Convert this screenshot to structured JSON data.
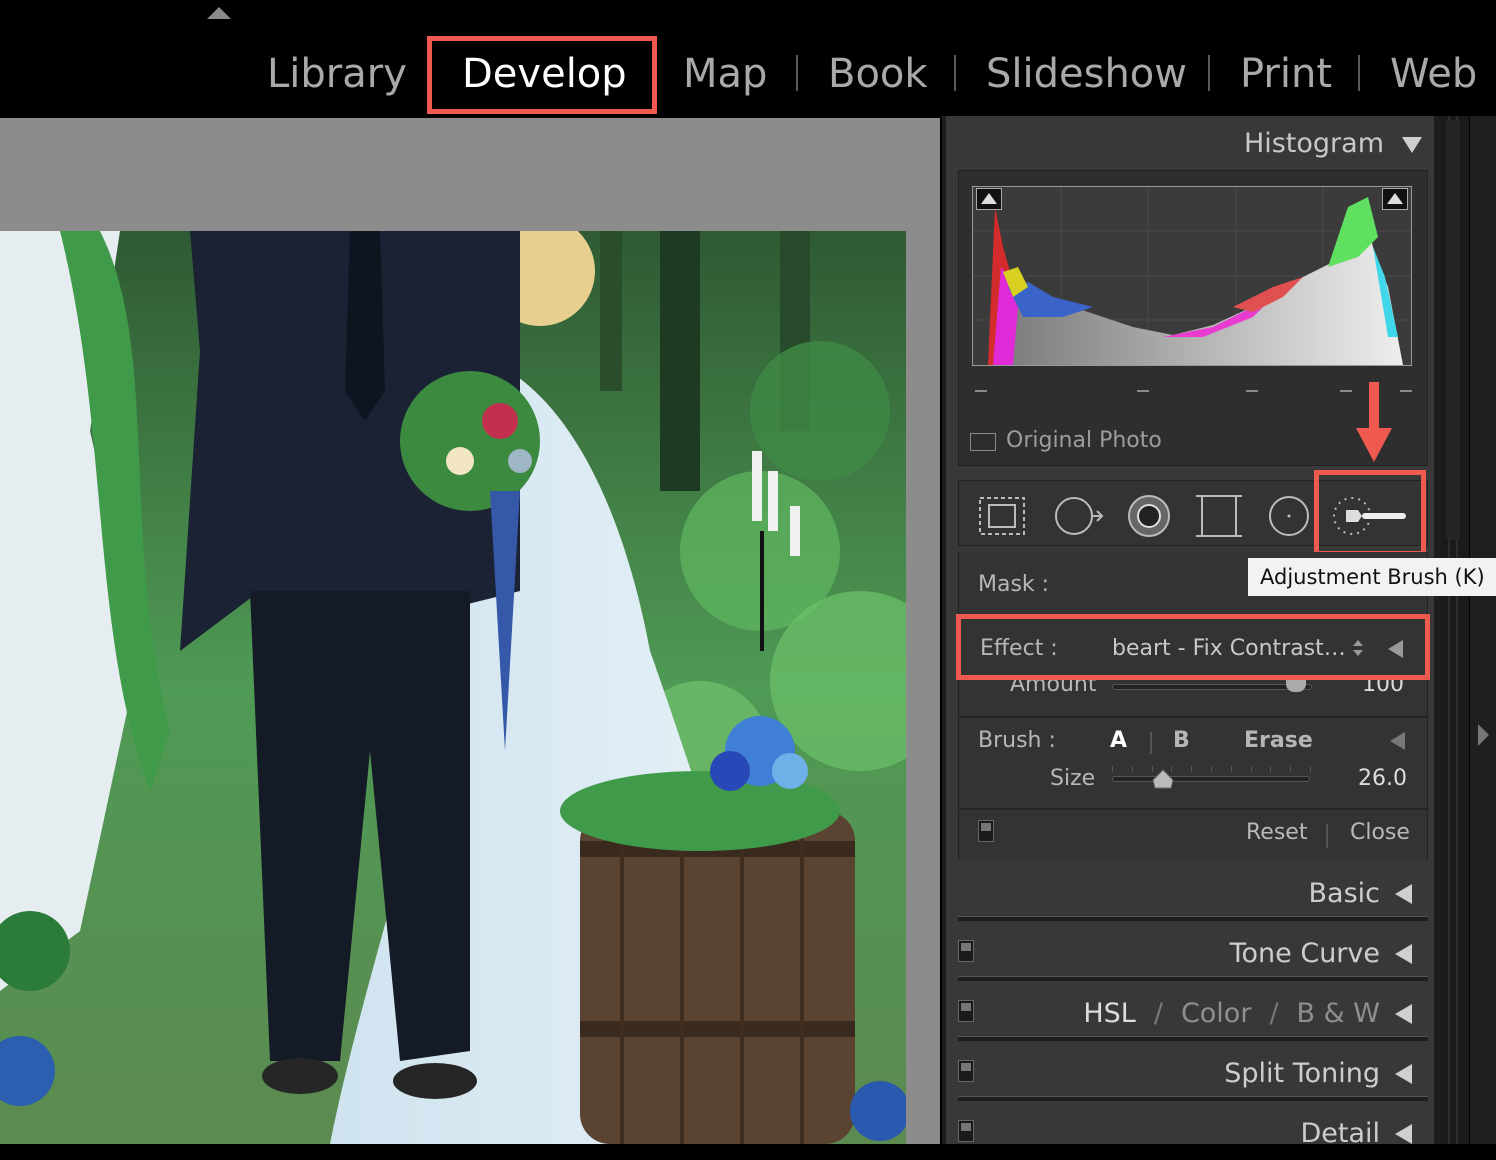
{
  "modules": {
    "items": [
      "Library",
      "Develop",
      "Map",
      "Book",
      "Slideshow",
      "Print",
      "Web"
    ],
    "active": "Develop"
  },
  "histogram": {
    "title": "Histogram",
    "original_photo_label": "Original Photo"
  },
  "tools": {
    "icons": [
      "crop-overlay-icon",
      "spot-removal-icon",
      "red-eye-icon",
      "graduated-filter-icon",
      "radial-filter-icon",
      "adjustment-brush-icon"
    ],
    "tooltip": "Adjustment Brush (K)"
  },
  "brush_panel": {
    "mask_label": "Mask :",
    "effect_label": "Effect :",
    "effect_value": "beart - Fix Contrast…",
    "amount_label": "Amount",
    "amount_value": "100",
    "amount_level": 1.0,
    "brush_label": "Brush :",
    "brush_a": "A",
    "brush_b": "B",
    "brush_erase": "Erase",
    "size_label": "Size",
    "size_value": "26.0",
    "size_level": 0.26,
    "reset_label": "Reset",
    "close_label": "Close"
  },
  "sections": {
    "basic": "Basic",
    "tone_curve": "Tone Curve",
    "hsl": "HSL",
    "color": "Color",
    "bw": "B & W",
    "sep": "/",
    "split_toning": "Split Toning",
    "detail": "Detail"
  },
  "colors": {
    "highlight": "#ee5a50",
    "panel_bg": "#383838",
    "tooltip_bg": "#f2f2f2"
  }
}
